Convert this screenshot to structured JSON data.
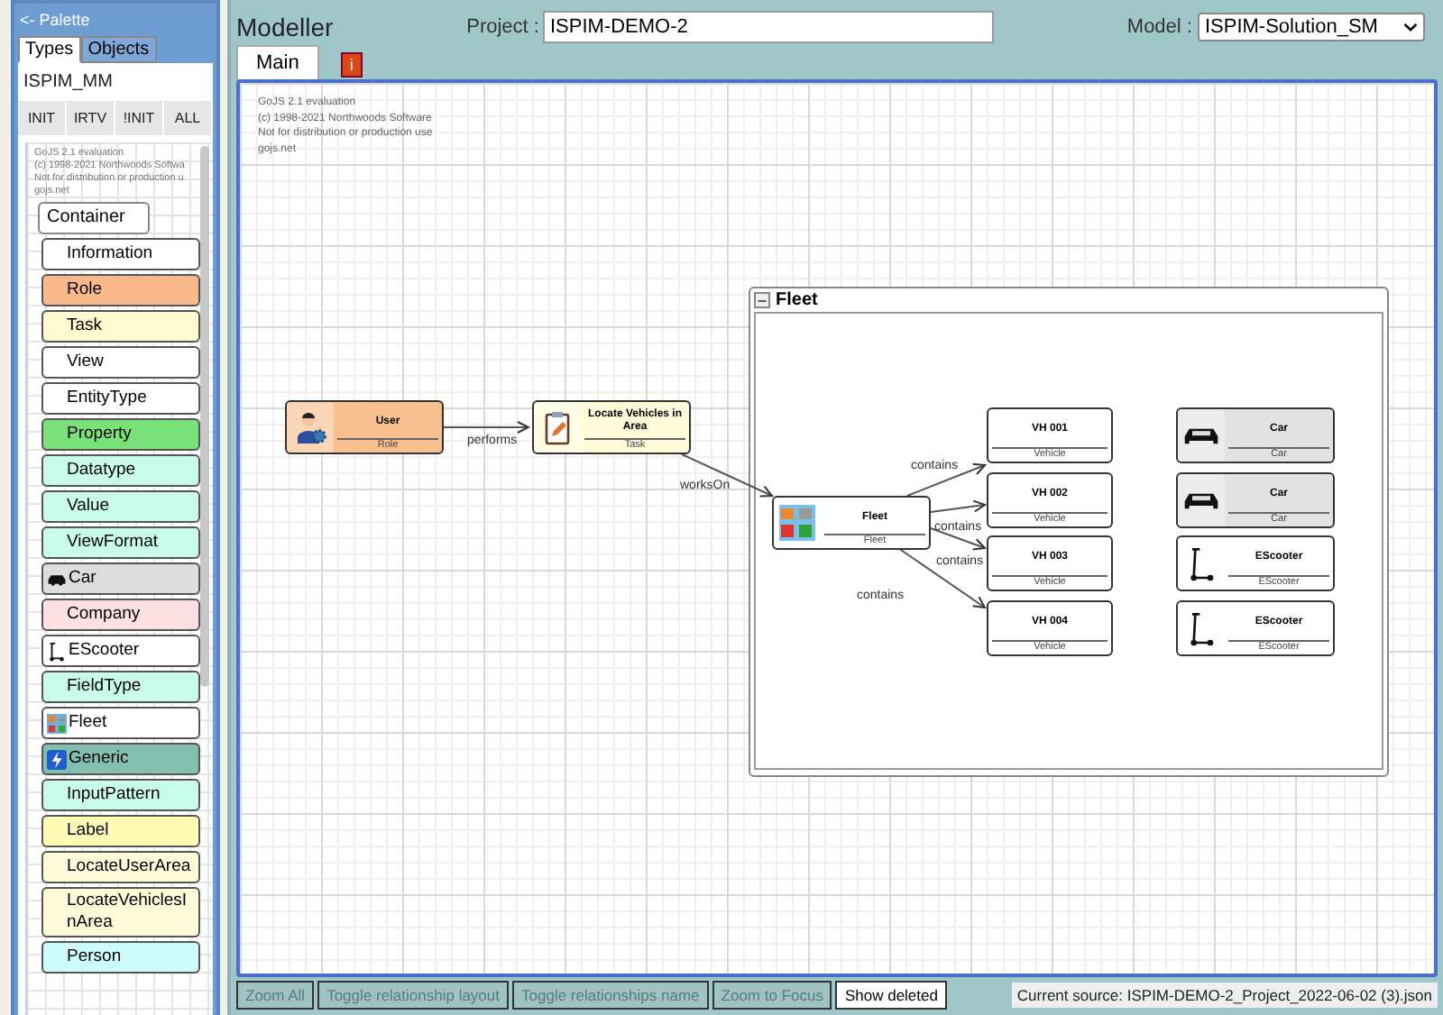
{
  "palette": {
    "title": "<- Palette",
    "tabs": [
      {
        "label": "Types",
        "selected": true
      },
      {
        "label": "Objects",
        "selected": false
      }
    ],
    "metamodel": "ISPIM_MM",
    "buttons": [
      "INIT",
      "IRTV",
      "!INIT",
      "ALL"
    ],
    "watermark": [
      "GoJS 2.1 evaluation",
      "(c) 1998-2021 Northwoods Softwa",
      "Not for distribution or production u",
      "gojs.net"
    ],
    "items": [
      {
        "label": "Container",
        "kind": "container",
        "color": "#ffffff"
      },
      {
        "label": "Information",
        "kind": "plain",
        "color": "#ffffff"
      },
      {
        "label": "Role",
        "kind": "plain",
        "color": "#f9b98a"
      },
      {
        "label": "Task",
        "kind": "plain",
        "color": "#fff9cf"
      },
      {
        "label": "View",
        "kind": "plain",
        "color": "#ffffff"
      },
      {
        "label": "EntityType",
        "kind": "plain",
        "color": "#ffffff"
      },
      {
        "label": "Property",
        "kind": "plain",
        "color": "#78e278"
      },
      {
        "label": "Datatype",
        "kind": "plain",
        "color": "#c9fbea"
      },
      {
        "label": "Value",
        "kind": "plain",
        "color": "#c9fbea"
      },
      {
        "label": "ViewFormat",
        "kind": "plain",
        "color": "#c9fbea"
      },
      {
        "label": "Car",
        "kind": "car",
        "color": "#dddddd"
      },
      {
        "label": "Company",
        "kind": "plain",
        "color": "#fde0e2"
      },
      {
        "label": "EScooter",
        "kind": "escooter",
        "color": "#ffffff"
      },
      {
        "label": "FieldType",
        "kind": "plain",
        "color": "#c9fbea"
      },
      {
        "label": "Fleet",
        "kind": "fleet",
        "color": "#ffffff"
      },
      {
        "label": "Generic",
        "kind": "generic",
        "color": "#82bfae"
      },
      {
        "label": "InputPattern",
        "kind": "plain",
        "color": "#c9fbea"
      },
      {
        "label": "Label",
        "kind": "plain",
        "color": "#fffbb5"
      },
      {
        "label": "LocateUserArea",
        "kind": "plain",
        "color": "#fffbd9"
      },
      {
        "label": "LocateVehiclesInArea",
        "kind": "plain",
        "color": "#fffbd9"
      },
      {
        "label": "Person",
        "kind": "plain",
        "color": "#ccfcfc"
      }
    ]
  },
  "header": {
    "title": "Modeller",
    "project_label": "Project :",
    "project": "ISPIM-DEMO-2",
    "model_label": "Model :",
    "model": "ISPIM-Solution_SM"
  },
  "tabs": [
    {
      "label": "Main",
      "selected": true
    }
  ],
  "info_button": "i",
  "canvas": {
    "watermark": [
      "GoJS 2.1 evaluation",
      "(c) 1998-2021 Northwoods Software",
      "Not for distribution or production use",
      "gojs.net"
    ],
    "group": {
      "toggle": "−",
      "title": "Fleet"
    },
    "nodes": [
      {
        "name": "User",
        "type": "Role",
        "kind": "role",
        "color": "#f9c08f"
      },
      {
        "name": "Locate Vehicles in Area",
        "type": "Task",
        "kind": "task",
        "color": "#fffbd8"
      },
      {
        "name": "Fleet",
        "type": "Fleet",
        "kind": "fleet",
        "color": "#ffffff"
      },
      {
        "name": "VH 001",
        "type": "Vehicle",
        "kind": "plain",
        "color": "#ffffff"
      },
      {
        "name": "VH 002",
        "type": "Vehicle",
        "kind": "plain",
        "color": "#ffffff"
      },
      {
        "name": "VH 003",
        "type": "Vehicle",
        "kind": "plain",
        "color": "#ffffff"
      },
      {
        "name": "VH 004",
        "type": "Vehicle",
        "kind": "plain",
        "color": "#ffffff"
      },
      {
        "name": "Car",
        "type": "Car",
        "kind": "car",
        "color": "#e2e2e2"
      },
      {
        "name": "Car",
        "type": "Car",
        "kind": "car",
        "color": "#e2e2e2"
      },
      {
        "name": "EScooter",
        "type": "EScooter",
        "kind": "escooter",
        "color": "#ffffff"
      },
      {
        "name": "EScooter",
        "type": "EScooter",
        "kind": "escooter",
        "color": "#ffffff"
      }
    ],
    "links": [
      "performs",
      "worksOn",
      "contains",
      "contains",
      "contains",
      "contains"
    ]
  },
  "toolbar": [
    {
      "label": "Zoom All",
      "disabled": true
    },
    {
      "label": "Toggle relationship layout",
      "disabled": true
    },
    {
      "label": "Toggle relationships name",
      "disabled": true
    },
    {
      "label": "Zoom to Focus",
      "disabled": true
    },
    {
      "label": "Show deleted",
      "disabled": false
    }
  ],
  "status": "Current source: ISPIM-DEMO-2_Project_2022-06-02 (3).json"
}
